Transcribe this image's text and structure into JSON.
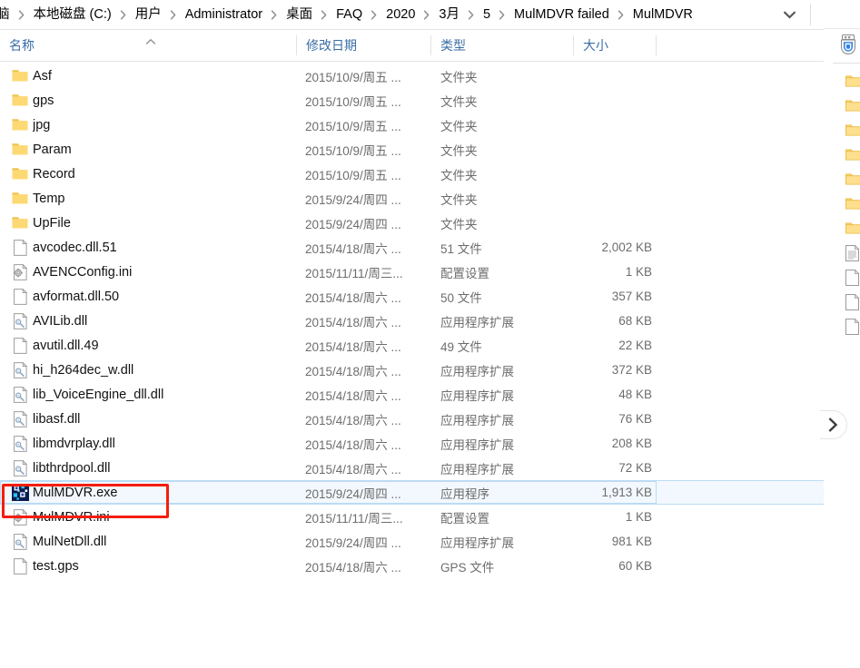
{
  "window": {
    "breadcrumb": {
      "items": [
        {
          "label": "脑"
        },
        {
          "label": "本地磁盘 (C:)"
        },
        {
          "label": "用户"
        },
        {
          "label": "Administrator"
        },
        {
          "label": "桌面"
        },
        {
          "label": "FAQ"
        },
        {
          "label": "2020"
        },
        {
          "label": "3月"
        },
        {
          "label": "5"
        },
        {
          "label": "MulMDVR failed"
        },
        {
          "label": "MulMDVR"
        }
      ],
      "dropdown_icon": "chevron-down-icon"
    },
    "expander_icon": "chevron-right-icon"
  },
  "columns": {
    "name": "名称",
    "date_modified": "修改日期",
    "type": "类型",
    "size": "大小",
    "sort": {
      "column": "名称",
      "direction": "ascending"
    }
  },
  "files": [
    {
      "icon": "folder-icon",
      "name": "Asf",
      "date": "2015/10/9/周五 ...",
      "type": "文件夹",
      "size": "",
      "selected": false
    },
    {
      "icon": "folder-icon",
      "name": "gps",
      "date": "2015/10/9/周五 ...",
      "type": "文件夹",
      "size": "",
      "selected": false
    },
    {
      "icon": "folder-icon",
      "name": "jpg",
      "date": "2015/10/9/周五 ...",
      "type": "文件夹",
      "size": "",
      "selected": false
    },
    {
      "icon": "folder-icon",
      "name": "Param",
      "date": "2015/10/9/周五 ...",
      "type": "文件夹",
      "size": "",
      "selected": false
    },
    {
      "icon": "folder-icon",
      "name": "Record",
      "date": "2015/10/9/周五 ...",
      "type": "文件夹",
      "size": "",
      "selected": false
    },
    {
      "icon": "folder-icon",
      "name": "Temp",
      "date": "2015/9/24/周四 ...",
      "type": "文件夹",
      "size": "",
      "selected": false
    },
    {
      "icon": "folder-icon",
      "name": "UpFile",
      "date": "2015/9/24/周四 ...",
      "type": "文件夹",
      "size": "",
      "selected": false
    },
    {
      "icon": "file-icon",
      "name": "avcodec.dll.51",
      "date": "2015/4/18/周六 ...",
      "type": "51 文件",
      "size": "2,002 KB",
      "selected": false
    },
    {
      "icon": "ini-icon",
      "name": "AVENCConfig.ini",
      "date": "2015/11/11/周三...",
      "type": "配置设置",
      "size": "1 KB",
      "selected": false
    },
    {
      "icon": "file-icon",
      "name": "avformat.dll.50",
      "date": "2015/4/18/周六 ...",
      "type": "50 文件",
      "size": "357 KB",
      "selected": false
    },
    {
      "icon": "dll-icon",
      "name": "AVILib.dll",
      "date": "2015/4/18/周六 ...",
      "type": "应用程序扩展",
      "size": "68 KB",
      "selected": false
    },
    {
      "icon": "file-icon",
      "name": "avutil.dll.49",
      "date": "2015/4/18/周六 ...",
      "type": "49 文件",
      "size": "22 KB",
      "selected": false
    },
    {
      "icon": "dll-icon",
      "name": "hi_h264dec_w.dll",
      "date": "2015/4/18/周六 ...",
      "type": "应用程序扩展",
      "size": "372 KB",
      "selected": false
    },
    {
      "icon": "dll-icon",
      "name": "lib_VoiceEngine_dll.dll",
      "date": "2015/4/18/周六 ...",
      "type": "应用程序扩展",
      "size": "48 KB",
      "selected": false
    },
    {
      "icon": "dll-icon",
      "name": "libasf.dll",
      "date": "2015/4/18/周六 ...",
      "type": "应用程序扩展",
      "size": "76 KB",
      "selected": false
    },
    {
      "icon": "dll-icon",
      "name": "libmdvrplay.dll",
      "date": "2015/4/18/周六 ...",
      "type": "应用程序扩展",
      "size": "208 KB",
      "selected": false
    },
    {
      "icon": "dll-icon",
      "name": "libthrdpool.dll",
      "date": "2015/4/18/周六 ...",
      "type": "应用程序扩展",
      "size": "72 KB",
      "selected": false
    },
    {
      "icon": "exe-icon",
      "name": "MulMDVR.exe",
      "date": "2015/9/24/周四 ...",
      "type": "应用程序",
      "size": "1,913 KB",
      "selected": true
    },
    {
      "icon": "ini-icon",
      "name": "MulMDVR.ini",
      "date": "2015/11/11/周三...",
      "type": "配置设置",
      "size": "1 KB",
      "selected": false
    },
    {
      "icon": "dll-icon",
      "name": "MulNetDll.dll",
      "date": "2015/9/24/周四 ...",
      "type": "应用程序扩展",
      "size": "981 KB",
      "selected": false
    },
    {
      "icon": "file-icon",
      "name": "test.gps",
      "date": "2015/4/18/周六 ...",
      "type": "GPS 文件",
      "size": "60 KB",
      "selected": false
    }
  ],
  "background_window": {
    "shield_icon": "usb-shield-icon",
    "icons": [
      "folder-icon",
      "folder-icon",
      "folder-icon",
      "folder-icon",
      "folder-icon",
      "folder-icon",
      "folder-icon",
      "text-file-icon",
      "file-icon",
      "file-icon",
      "file-icon"
    ]
  },
  "annotation": {
    "type": "red-rectangle-highlight",
    "color": "#f51d0e",
    "target": "MulMDVR.exe"
  }
}
